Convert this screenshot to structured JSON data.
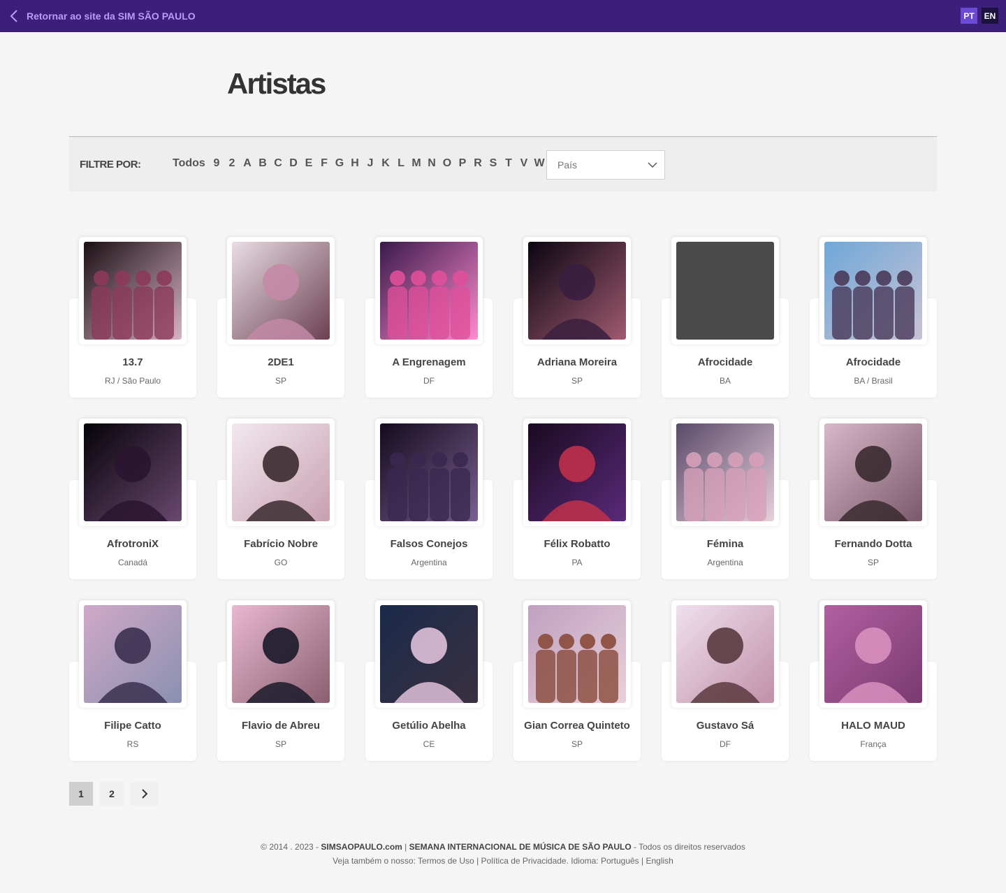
{
  "topbar": {
    "back_label": "Retornar ao site da SIM SÃO PAULO",
    "langs": [
      "PT",
      "EN"
    ],
    "active_lang": "PT",
    "bg_color": "#3b1f7a",
    "accent_color": "#6b4bd6"
  },
  "page": {
    "title": "Artistas"
  },
  "filter": {
    "label": "FILTRE POR:",
    "letters": [
      "Todos",
      "9",
      "2",
      "A",
      "B",
      "C",
      "D",
      "E",
      "F",
      "G",
      "H",
      "J",
      "K",
      "L",
      "M",
      "N",
      "O",
      "P",
      "R",
      "S",
      "T",
      "V",
      "W"
    ],
    "country_placeholder": "País"
  },
  "artists": [
    {
      "name": "13.7",
      "location": "RJ / São Paulo",
      "photo": "band-photo"
    },
    {
      "name": "2DE1",
      "location": "SP",
      "photo": "artist-photo"
    },
    {
      "name": "A Engrenagem",
      "location": "DF",
      "photo": "band-photo"
    },
    {
      "name": "Adriana Moreira",
      "location": "SP",
      "photo": "artist-photo"
    },
    {
      "name": "Afrocidade",
      "location": "BA",
      "photo": "placeholder"
    },
    {
      "name": "Afrocidade",
      "location": "BA / Brasil",
      "photo": "band-photo"
    },
    {
      "name": "AfrotroniX",
      "location": "Canadá",
      "photo": "artist-photo"
    },
    {
      "name": "Fabrício Nobre",
      "location": "GO",
      "photo": "artist-photo"
    },
    {
      "name": "Falsos Conejos",
      "location": "Argentina",
      "photo": "band-photo"
    },
    {
      "name": "Félix Robatto",
      "location": "PA",
      "photo": "artist-photo"
    },
    {
      "name": "Fémina",
      "location": "Argentina",
      "photo": "band-photo"
    },
    {
      "name": "Fernando Dotta",
      "location": "SP",
      "photo": "artist-photo"
    },
    {
      "name": "Filipe Catto",
      "location": "RS",
      "photo": "artist-photo"
    },
    {
      "name": "Flavio de Abreu",
      "location": "SP",
      "photo": "artist-photo"
    },
    {
      "name": "Getúlio Abelha",
      "location": "CE",
      "photo": "artist-photo"
    },
    {
      "name": "Gian Correa Quinteto",
      "location": "SP",
      "photo": "band-photo"
    },
    {
      "name": "Gustavo Sá",
      "location": "DF",
      "photo": "artist-photo"
    },
    {
      "name": "HALO MAUD",
      "location": "França",
      "photo": "artist-photo"
    }
  ],
  "pagination": {
    "pages": [
      "1",
      "2"
    ],
    "current": "1",
    "next_icon": "chevron-right-icon"
  },
  "footer": {
    "line1_prefix": "© 2014 . 2023 - ",
    "site": "SIMSAOPAULO.com",
    "sep": " | ",
    "event": "SEMANA INTERNACIONAL DE MÚSICA DE SÃO PAULO",
    "rights": " - Todos os direitos reservados",
    "line2_prefix": "Veja também o nosso: ",
    "terms": "Termos de Uso",
    "privacy": "Política de Privacidade",
    "lang_prefix": ". Idioma: ",
    "lang_pt": "Português",
    "lang_en": "English"
  }
}
